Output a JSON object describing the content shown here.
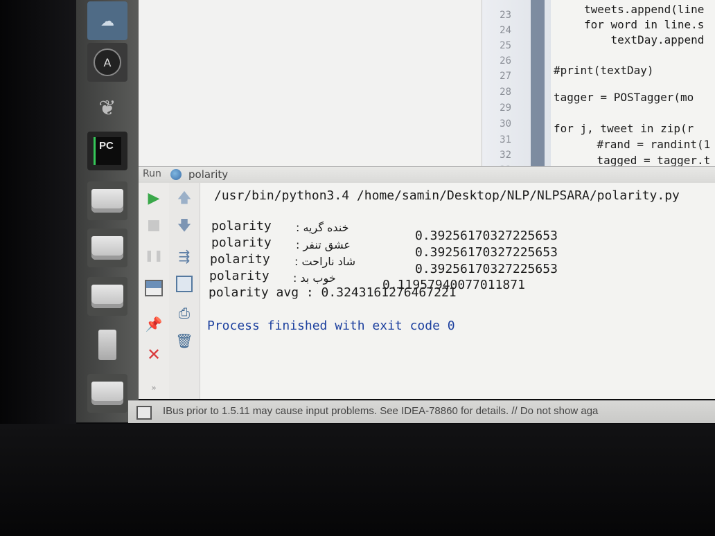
{
  "launcher": {
    "items": [
      "ubuntu-one-icon",
      "system-update-icon",
      "feather-app-icon",
      "pycharm-icon",
      "drive-icon",
      "drive-icon",
      "drive-icon",
      "drive-icon",
      "usb-drive-icon"
    ],
    "pycharm_label": "PC"
  },
  "editor": {
    "line_numbers": [
      "23",
      "24",
      "25",
      "26",
      "27",
      "28",
      "29",
      "30",
      "31",
      "32",
      "33"
    ],
    "code": [
      "tweets.append(line",
      "for word in line.s",
      "    textDay.append",
      "",
      "#print(textDay)",
      "",
      "tagger = POSTagger(mo",
      "",
      "for j, tweet in zip(r",
      "    #rand = randint(1",
      "    tagged = tagger.t"
    ]
  },
  "run_panel": {
    "tab_label": "Run",
    "config_name": "polarity"
  },
  "console": {
    "command": "/usr/bin/python3.4 /home/samin/Desktop/NLP/NLPSARA/polarity.py",
    "results": [
      {
        "label": "polarity",
        "words": "خنده گریه :",
        "value": "0.39256170327225653"
      },
      {
        "label": "polarity",
        "words": "عشق تنفر :",
        "value": "0.39256170327225653"
      },
      {
        "label": "polarity",
        "words": "شاد ناراحت :",
        "value": "0.39256170327225653"
      },
      {
        "label": "polarity",
        "words": "خوب بد :",
        "value": "0.11957940077011871"
      }
    ],
    "average": "polarity avg : 0.3243161276467221",
    "exit_message": "Process finished with exit code 0"
  },
  "status_bar": {
    "message": "IBus prior to 1.5.11 may cause input problems. See IDEA-78860 for details. // Do not show aga"
  },
  "colors": {
    "run_green": "#3aa84a",
    "stop_red": "#d9393b",
    "process_blue": "#1b3f9e"
  }
}
